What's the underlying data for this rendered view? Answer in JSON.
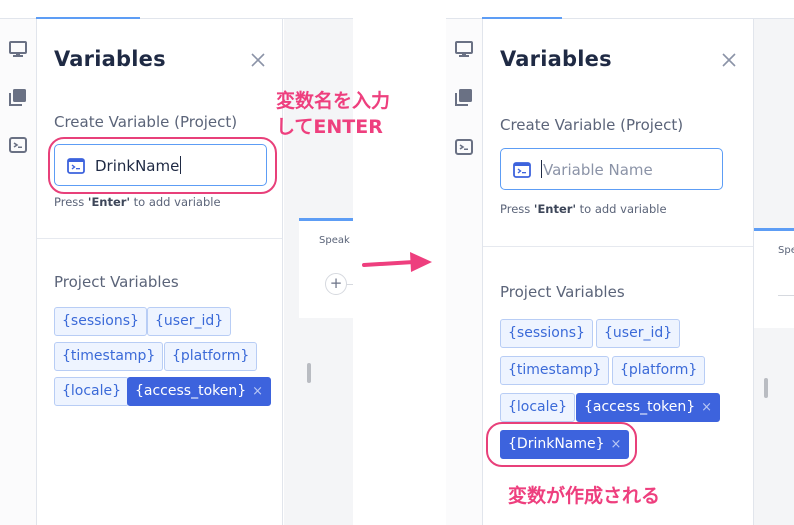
{
  "panel": {
    "title": "Variables",
    "create_label": "Create Variable (Project)",
    "hint_prefix": "Press ",
    "hint_key": "'Enter'",
    "hint_suffix": " to add variable",
    "section_label": "Project Variables"
  },
  "before": {
    "input_value": "DrinkName",
    "speak_label": "Speak",
    "variables": [
      "{sessions}",
      "{user_id}",
      "{timestamp}",
      "{platform}",
      "{locale}",
      "{access_token}"
    ],
    "remove_symbol": "×"
  },
  "after": {
    "input_placeholder": "Variable Name",
    "speak_label": "Spe",
    "variables": [
      "{sessions}",
      "{user_id}",
      "{timestamp}",
      "{platform}",
      "{locale}",
      "{access_token}",
      "{DrinkName}"
    ],
    "remove_symbol": "×"
  },
  "annotations": {
    "enter_line1": "変数名を入力",
    "enter_line2": "してENTER",
    "created": "変数が作成される"
  },
  "icons": [
    "monitor-icon",
    "layers-icon",
    "terminal-icon",
    "close-icon",
    "variable-icon",
    "arrow-right-icon"
  ],
  "colors": {
    "accent": "#3d63dd",
    "chip_bg": "#eef4ff",
    "annotation": "#ee3f7e",
    "focus": "#5d9df5"
  }
}
